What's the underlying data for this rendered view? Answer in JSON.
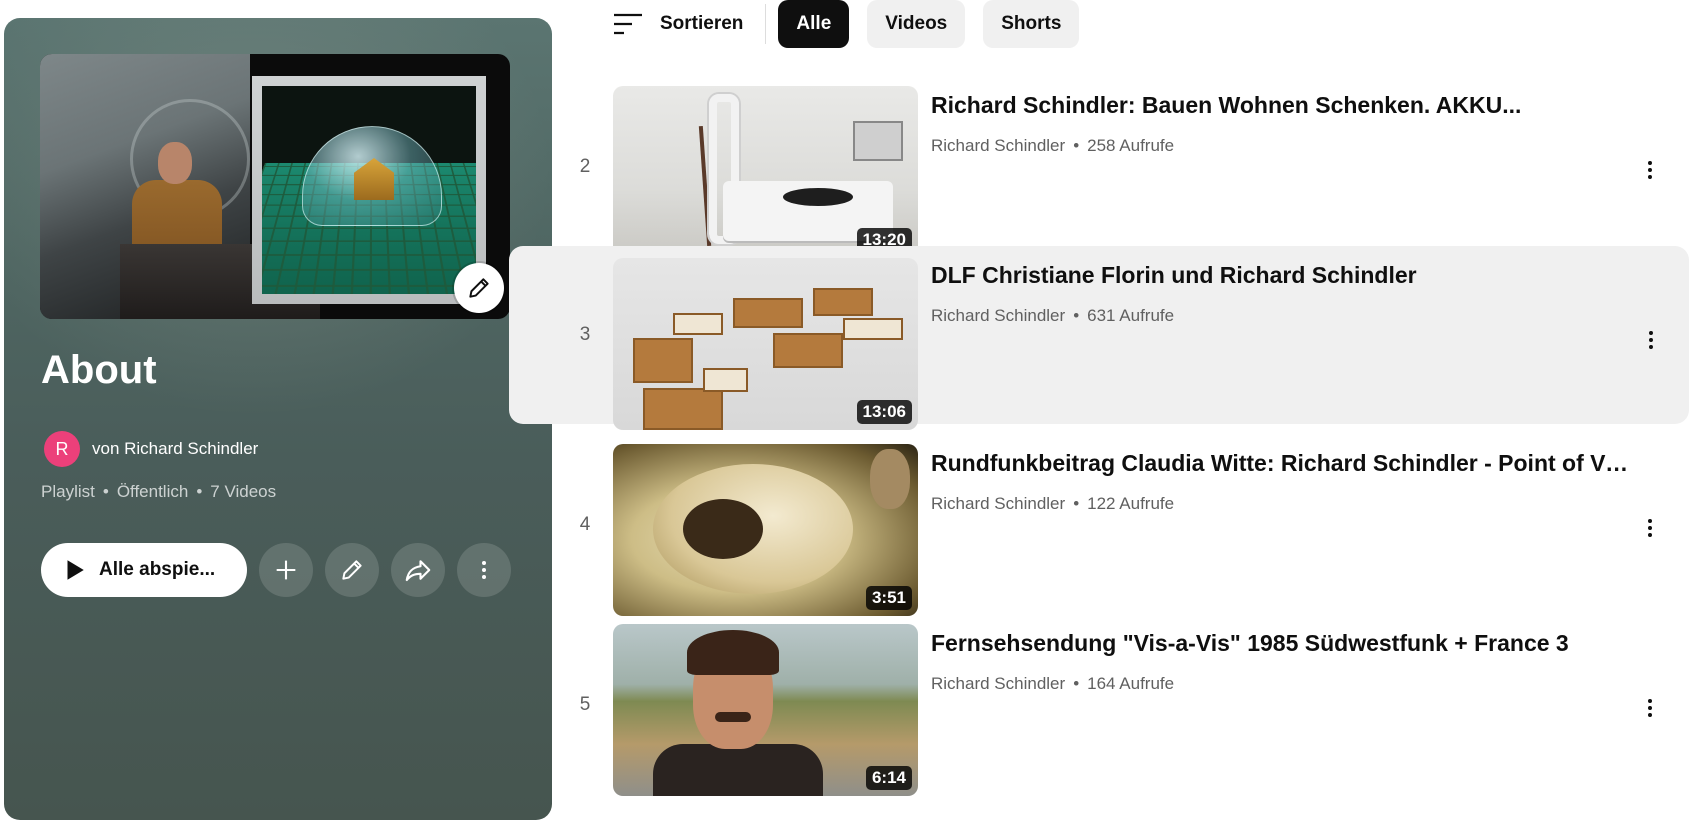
{
  "playlist": {
    "title": "About",
    "owner_initial": "R",
    "owner_text": "von Richard Schindler",
    "meta": [
      "Playlist",
      "Öffentlich",
      "7 Videos"
    ],
    "play_all_label": "Alle abspie...",
    "icons": {
      "edit": "pencil-icon",
      "play": "play-icon",
      "add": "plus-icon",
      "share": "share-icon",
      "more": "more-vert-icon"
    }
  },
  "filters": {
    "sort_label": "Sortieren",
    "chips": [
      {
        "label": "Alle",
        "active": true
      },
      {
        "label": "Videos",
        "active": false
      },
      {
        "label": "Shorts",
        "active": false
      }
    ]
  },
  "videos": [
    {
      "index": "2",
      "title": "Richard Schindler: Bauen Wohnen Schenken. AKKU...",
      "channel": "Richard Schindler",
      "views": "258 Aufrufe",
      "duration": "13:20"
    },
    {
      "index": "3",
      "title": "DLF Christiane Florin und Richard Schindler",
      "channel": "Richard Schindler",
      "views": "631 Aufrufe",
      "duration": "13:06"
    },
    {
      "index": "4",
      "title": "Rundfunkbeitrag Claudia Witte: Richard Schindler - Point of Vie...",
      "channel": "Richard Schindler",
      "views": "122 Aufrufe",
      "duration": "3:51"
    },
    {
      "index": "5",
      "title": "Fernsehsendung \"Vis-a-Vis\" 1985 Südwestfunk + France 3",
      "channel": "Richard Schindler",
      "views": "164 Aufrufe",
      "duration": "6:14"
    }
  ],
  "colors": {
    "panel": "#4f6662",
    "avatar": "#ec407a",
    "chip_active": "#0f0f0f",
    "chip": "#f0f0f0",
    "hover_row": "#f0f0f0"
  }
}
